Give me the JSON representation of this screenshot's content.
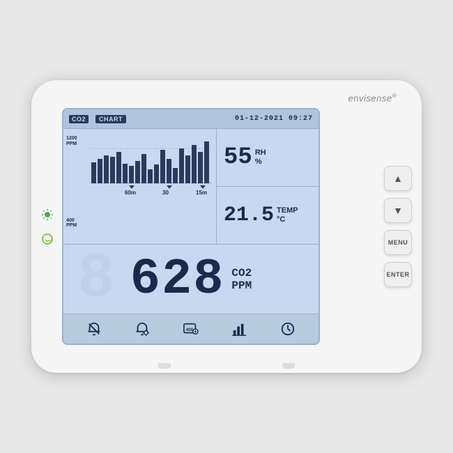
{
  "brand": {
    "name": "envisense",
    "trademark": "®"
  },
  "screen": {
    "topbar": {
      "co2_label": "CO2",
      "chart_label": "CHART",
      "datetime": "01-12-2021 09:27"
    },
    "chart": {
      "y_labels": [
        "1200\nPPM",
        "400\nPPM"
      ],
      "y_top": "1200",
      "y_top_unit": "PPM",
      "y_bottom": "400",
      "y_bottom_unit": "PPM",
      "x_labels": [
        "60m",
        "30",
        "15m"
      ]
    },
    "humidity": {
      "value": "55",
      "unit": "RH\n%"
    },
    "temperature": {
      "value": "21.5",
      "unit": "TEMP\n°C"
    },
    "co2_reading": {
      "value": "628",
      "label": "CO2",
      "unit": "PPM"
    },
    "bottombar": {
      "icons": [
        "alarm-off",
        "alarm-settings",
        "calibration",
        "chart-bar",
        "clock"
      ]
    }
  },
  "buttons": {
    "up": "▲",
    "down": "▼",
    "menu": "MENU",
    "enter": "ENTER"
  }
}
